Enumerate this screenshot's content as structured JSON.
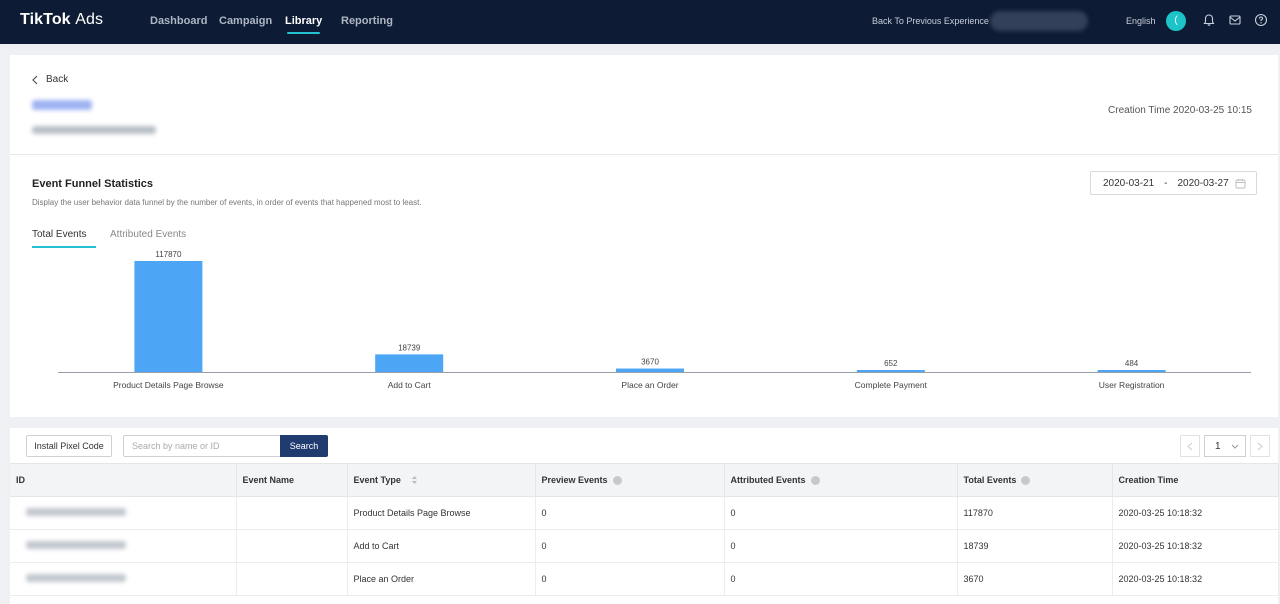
{
  "nav": {
    "logo_main": "TikTok",
    "logo_sub": "Ads",
    "tabs": [
      "Dashboard",
      "Campaign",
      "Library",
      "Reporting"
    ],
    "active_tab": "Library",
    "back_previous": "Back To Previous Experience",
    "language": "English",
    "avatar_letter": "("
  },
  "header": {
    "back_label": "Back",
    "creation_time": "Creation Time 2020-03-25 10:15"
  },
  "funnel": {
    "title": "Event Funnel Statistics",
    "description": "Display the user behavior data funnel by the number of events, in order of events that happened most to least.",
    "date_start": "2020-03-21",
    "date_sep": "-",
    "date_end": "2020-03-27",
    "tabs": [
      "Total Events",
      "Attributed Events"
    ]
  },
  "chart_data": {
    "type": "bar",
    "categories": [
      "Product Details Page Browse",
      "Add to Cart",
      "Place an Order",
      "Complete Payment",
      "User Registration"
    ],
    "values": [
      117870,
      18739,
      3670,
      652,
      484
    ],
    "ylim": [
      0,
      117870
    ],
    "bar_color": "#4da6f5",
    "grid": false
  },
  "toolbar": {
    "install_label": "Install Pixel Code",
    "search_placeholder": "Search by name or ID",
    "search_label": "Search",
    "page": "1"
  },
  "table": {
    "columns": [
      "ID",
      "Event Name",
      "Event Type",
      "Preview Events",
      "Attributed Events",
      "Total Events",
      "Creation Time"
    ],
    "rows": [
      {
        "event_type": "Product Details Page Browse",
        "preview": "0",
        "attributed": "0",
        "total": "117870",
        "created": "2020-03-25 10:18:32"
      },
      {
        "event_type": "Add to Cart",
        "preview": "0",
        "attributed": "0",
        "total": "18739",
        "created": "2020-03-25 10:18:32"
      },
      {
        "event_type": "Place an Order",
        "preview": "0",
        "attributed": "0",
        "total": "3670",
        "created": "2020-03-25 10:18:32"
      }
    ]
  },
  "colors": {
    "nav_bg": "#0d1b34",
    "accent": "#25c0d1",
    "search_button": "#1f3b6f"
  }
}
